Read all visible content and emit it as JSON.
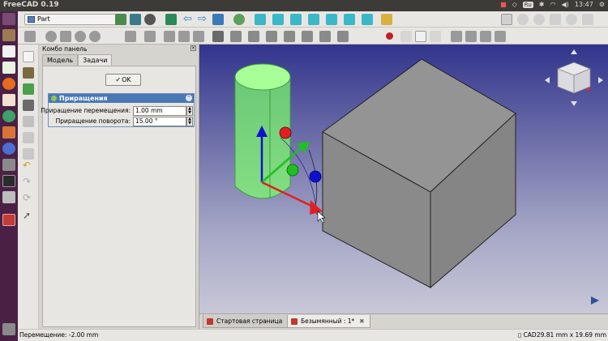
{
  "system_bar": {
    "app_title": "FreeCAD 0.19",
    "keyboard_layout": "Ru",
    "time": "13:47"
  },
  "toolbar": {
    "workbench_selected": "Part"
  },
  "combo_panel": {
    "title": "Комбо панель",
    "tabs": [
      {
        "label": "Модель",
        "active": false
      },
      {
        "label": "Задачи",
        "active": true
      }
    ],
    "ok_label": "OK",
    "increments": {
      "header": "Приращения",
      "translation_label": "Приращение перемещения:",
      "translation_value": "1.00 mm",
      "rotation_label": "Приращение поворота:",
      "rotation_value": "15.00 °"
    }
  },
  "document_tabs": [
    {
      "label": "Стартовая страница",
      "active": false
    },
    {
      "label": "Безымянный : 1*",
      "active": true
    }
  ],
  "status_bar": {
    "message": "Перемещение: -2.00 mm",
    "navigation_style": "CAD",
    "dimensions": "29.81 mm x 19.69 mm"
  },
  "colors": {
    "title_bar": "#3c3b37",
    "launcher": "#4a2145",
    "viewport_top": "#32348c",
    "viewport_bottom": "#c8c8d8",
    "cylinder_highlight": "#7dff6a",
    "box_face": "#8c8c8c",
    "axis_x": "#e02020",
    "axis_y": "#20c020",
    "axis_z": "#1010d0"
  }
}
